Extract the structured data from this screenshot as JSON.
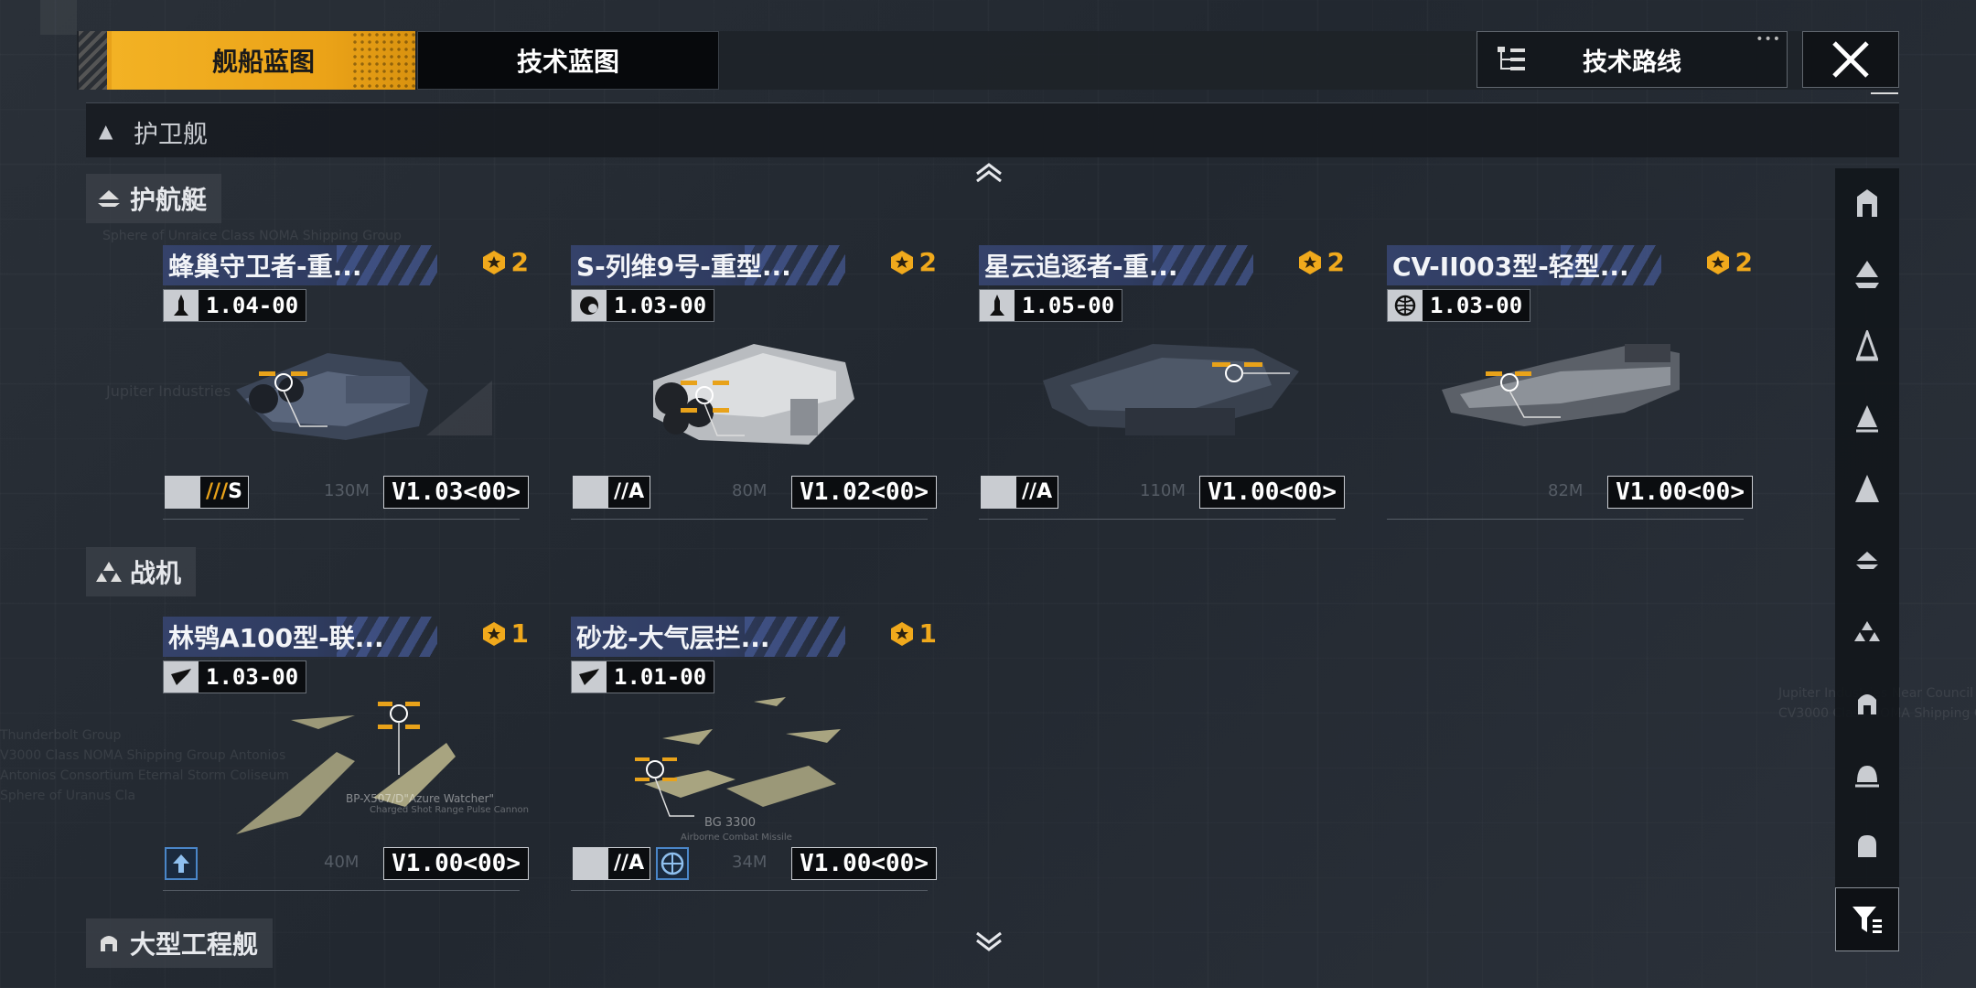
{
  "tabs": {
    "ship_blueprint": "舰船蓝图",
    "tech_blueprint": "技术蓝图"
  },
  "header": {
    "tech_route_label": "技术路线"
  },
  "category": {
    "label": "护卫舰"
  },
  "sections": [
    {
      "label": "护航艇",
      "icon": "escort-boat-icon"
    },
    {
      "label": "战机",
      "icon": "fighter-icon"
    },
    {
      "label": "大型工程舰",
      "icon": "large-engineering-ship-icon"
    }
  ],
  "cards": [
    {
      "title": "蜂巢守卫者-重...",
      "rank": "2",
      "version": "1.04-00",
      "ver_icon": "rocket-icon",
      "tag_text": "S",
      "tag_stripes": "///",
      "build_version": "V1.03<00>",
      "size": "130M"
    },
    {
      "title": "S-列维9号-重型...",
      "rank": "2",
      "version": "1.03-00",
      "ver_icon": "faction-gear-icon",
      "tag_text": "A",
      "tag_stripes": "//",
      "build_version": "V1.02<00>",
      "size": "80M"
    },
    {
      "title": "星云追逐者-重...",
      "rank": "2",
      "version": "1.05-00",
      "ver_icon": "rocket-icon",
      "tag_text": "A",
      "tag_stripes": "//",
      "build_version": "V1.00<00>",
      "size": "110M"
    },
    {
      "title": "CV-II003型-轻型...",
      "rank": "2",
      "version": "1.03-00",
      "ver_icon": "globe-icon",
      "tag_text": "",
      "tag_stripes": "",
      "build_version": "V1.00<00>",
      "size": "82M"
    },
    {
      "title": "林鸮A100型-联...",
      "rank": "1",
      "version": "1.03-00",
      "ver_icon": "wing-icon",
      "tag_text": "",
      "tag_stripes": "",
      "build_version": "V1.00<00>",
      "size": "40M"
    },
    {
      "title": "砂龙-大气层拦...",
      "rank": "1",
      "version": "1.01-00",
      "ver_icon": "wing-icon",
      "tag_text": "A",
      "tag_stripes": "//",
      "build_version": "V1.00<00>",
      "size": "34M"
    }
  ],
  "rail": [
    "hangar-icon",
    "carrier-icon",
    "frigate-icon",
    "destroyer-icon",
    "cruiser-icon",
    "escort-boat-icon",
    "fighter-icon",
    "large-engineering-ship-icon",
    "dome-icon",
    "capsule-icon"
  ],
  "bg_texts": {
    "t1": "Sphere of Unraice Class NOMA Shipping Group",
    "t2": "Jupiter Industries",
    "t3": "Thunderbolt Group",
    "t4": "V3000 Class NOMA Shipping Group Antonios",
    "t5": "Antonios Consortium Eternal Storm Coliseum",
    "t6": "Sphere of Uranus Cla",
    "t7": "Jupiter Industries Near Council",
    "t8": "CV3000 Class NOMA Shipping Group",
    "w1": "BP-X507/D\"Azure Watcher\"",
    "w1b": "Charged Shot Range Pulse Cannon",
    "w2": "BG 3300",
    "w2b": "Airborne Combat Missile"
  }
}
